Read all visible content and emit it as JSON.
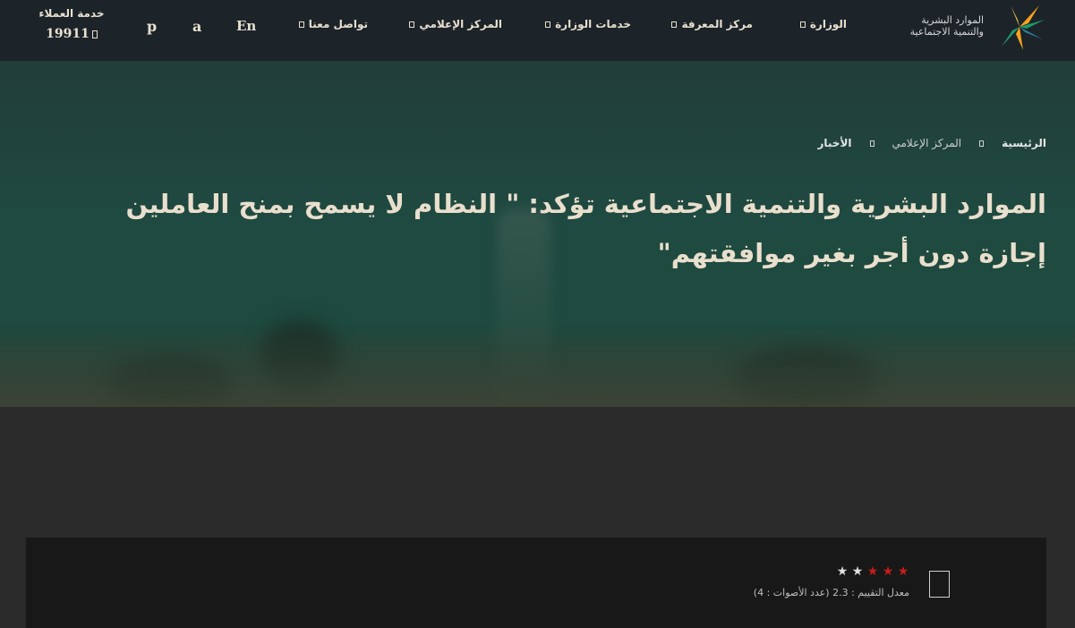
{
  "header": {
    "logo_line1": "الموارد البشرية",
    "logo_line2": "والتنمية الاجتماعية",
    "nav": [
      {
        "label": "الوزارة"
      },
      {
        "label": "مركز المعرفة"
      },
      {
        "label": "خدمات الوزارة"
      },
      {
        "label": "المركز الإعلامي"
      },
      {
        "label": "تواصل معنا"
      }
    ],
    "lang_en": "En",
    "lang_a": "a",
    "lang_p": "p",
    "hotline_label": "خدمة العملاء",
    "hotline_number": "19911"
  },
  "breadcrumb": {
    "home": "الرئيسية",
    "media": "المركز الإعلامي",
    "current": "الأخبار"
  },
  "article": {
    "title": "الموارد البشرية والتنمية الاجتماعية تؤكد: \" النظام لا يسمح بمنح العاملين إجازة دون أجر بغير موافقتهم\""
  },
  "rating": {
    "value": 2.3,
    "stars_filled": 3,
    "stars_total": 5,
    "summary": "معدل التقييم : 2.3 (عدد الأصوات : 4)",
    "star_glyph": "★"
  },
  "colors": {
    "header_bg": "#1c2329",
    "hero_green": "#1f4a41",
    "title_text": "#e9dfcd",
    "star_on": "#c81d1d",
    "star_off": "#e0e0e0",
    "logo_orange": "#f4a11e",
    "logo_green": "#1f9a6a",
    "logo_teal": "#2b7f9e"
  }
}
